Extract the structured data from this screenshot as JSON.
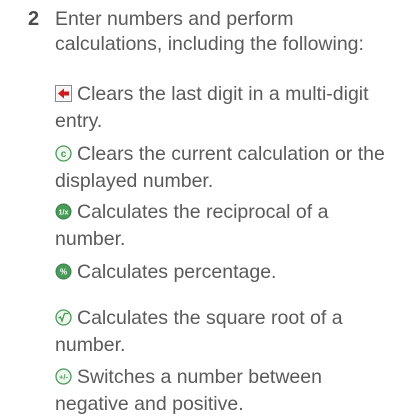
{
  "step": {
    "number": "2",
    "intro": "Enter numbers and perform calculations, including the following:"
  },
  "items": [
    {
      "icon": "backspace-icon",
      "text": "Clears the last digit in a multi-digit entry."
    },
    {
      "icon": "clear-icon",
      "text": "Clears the current calculation or the displayed number."
    },
    {
      "icon": "reciprocal-icon",
      "text": "Calculates the reciprocal of a number."
    },
    {
      "icon": "percent-icon",
      "text": "Calculates percentage."
    },
    {
      "icon": "square-root-icon",
      "text": "Calculates the square root of a number."
    },
    {
      "icon": "plus-minus-icon",
      "text": "Switches a number between negative and positive."
    }
  ],
  "colors": {
    "text": "#5a5a5a",
    "step_number": "#4b4b4b",
    "backspace_arrow": "#cc1a1a",
    "icon_green": "#4a9a5a"
  }
}
